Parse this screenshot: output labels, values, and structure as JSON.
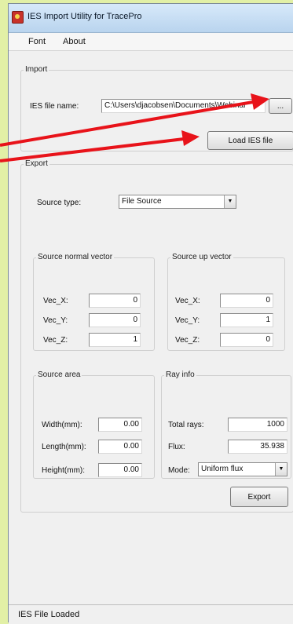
{
  "window": {
    "title": "IES Import Utility for TracePro"
  },
  "menu": {
    "items": [
      "Font",
      "About"
    ]
  },
  "import": {
    "legend": "Import",
    "file_label": "IES file name:",
    "file_value": "C:\\Users\\djacobsen\\Documents\\Webinar",
    "browse_label": "...",
    "load_label": "Load IES file"
  },
  "export": {
    "legend": "Export",
    "source_type_label": "Source type:",
    "source_type_value": "File Source",
    "normal": {
      "legend": "Source normal vector",
      "x_label": "Vec_X:",
      "x_value": "0",
      "y_label": "Vec_Y:",
      "y_value": "0",
      "z_label": "Vec_Z:",
      "z_value": "1"
    },
    "up": {
      "legend": "Source up vector",
      "x_label": "Vec_X:",
      "x_value": "0",
      "y_label": "Vec_Y:",
      "y_value": "1",
      "z_label": "Vec_Z:",
      "z_value": "0"
    },
    "area": {
      "legend": "Source area",
      "width_label": "Width(mm):",
      "width_value": "0.00",
      "length_label": "Length(mm):",
      "length_value": "0.00",
      "height_label": "Height(mm):",
      "height_value": "0.00"
    },
    "ray": {
      "legend": "Ray info",
      "total_label": "Total rays:",
      "total_value": "1000",
      "flux_label": "Flux:",
      "flux_value": "35.938",
      "mode_label": "Mode:",
      "mode_value": "Uniform flux"
    },
    "export_label": "Export"
  },
  "status": {
    "text": "IES File Loaded"
  },
  "colors": {
    "annotation_arrow": "#e8131a",
    "background": "#e2f0a6"
  }
}
